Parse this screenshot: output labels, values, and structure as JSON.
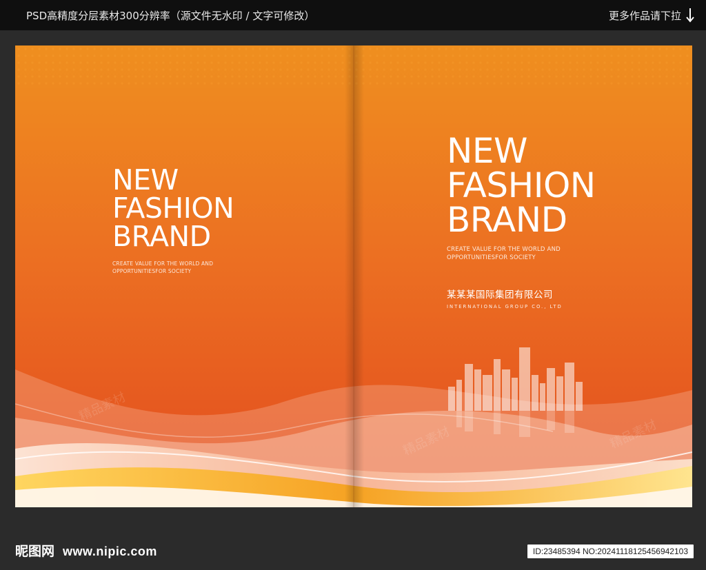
{
  "topbar": {
    "left_text": "PSD高精度分层素材300分辨率（源文件无水印 / 文字可修改）",
    "right_text": "更多作品请下拉",
    "icon": "arrow-down-icon"
  },
  "cover_left": {
    "headline": [
      "NEW",
      "FASHION",
      "BRAND"
    ],
    "tagline": [
      "CREATE VALUE FOR THE WORLD AND",
      "OPPORTUNITIESFOR SOCIETY"
    ]
  },
  "cover_right": {
    "headline": [
      "NEW",
      "FASHION",
      "BRAND"
    ],
    "tagline": [
      "CREATE VALUE FOR THE WORLD AND",
      "OPPORTUNITIESFOR SOCIETY"
    ],
    "company_cn": "某某某国际集团有限公司",
    "company_en": "INTERNATIONAL GROUP CO., LTD"
  },
  "watermark": "精品素材",
  "footer": {
    "logo_cn": "昵图网",
    "logo_url": "www.nipic.com",
    "id_text": "ID:23485394 NO:20241118125456942103"
  },
  "colors": {
    "orange_top": "#ef8f1f",
    "orange_mid": "#ec6f22",
    "orange_deep": "#e4501f",
    "page_bg": "#2b2b2b",
    "topbar_bg": "#0f0f0f"
  }
}
